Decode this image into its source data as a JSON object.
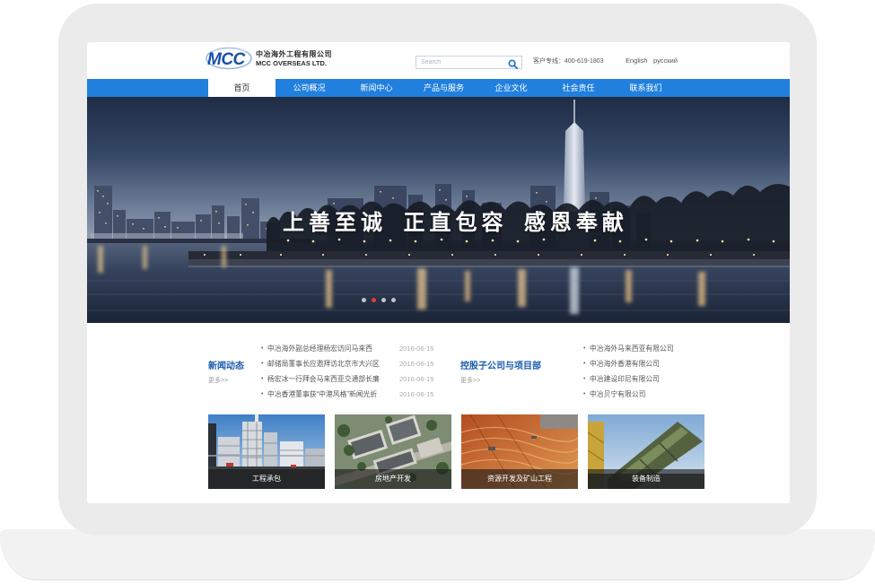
{
  "header": {
    "logo_text": "MCC",
    "company_cn": "中冶海外工程有限公司",
    "company_en": "MCC OVERSEAS LTD.",
    "search_placeholder": "Search",
    "hotline": "客户专线：400-619-1803",
    "languages": [
      "English",
      "русский"
    ]
  },
  "nav": {
    "items": [
      {
        "label": "首页",
        "active": true
      },
      {
        "label": "公司概况"
      },
      {
        "label": "新闻中心"
      },
      {
        "label": "产品与服务"
      },
      {
        "label": "企业文化"
      },
      {
        "label": "社会责任"
      },
      {
        "label": "联系我们"
      }
    ]
  },
  "banner": {
    "slogan": [
      "上善至诚",
      "正直包容",
      "感恩奉献"
    ],
    "dot_count": 4,
    "active_dot": 2
  },
  "news": {
    "title": "新闻动态",
    "more": "更多>>",
    "items": [
      {
        "title": "中冶海外副总经理杨宏访问马来西",
        "date": "2016-06-15"
      },
      {
        "title": "邮储局董事长应邀拜访北京市大兴区",
        "date": "2016-06-15"
      },
      {
        "title": "杨宏冰一行拜会马来西亚交通部长廉",
        "date": "2016-06-15"
      },
      {
        "title": "中冶香港董事获“中港风格”新闻光折",
        "date": "2016-06-15"
      }
    ]
  },
  "subsidiaries": {
    "title": "控股子公司与项目部",
    "more": "更多>>",
    "items": [
      "中冶海外马来西亚有限公司",
      "中冶海外香港有限公司",
      "中冶建设印尼有限公司",
      "中冶贝宁有限公司"
    ]
  },
  "tiles": [
    {
      "caption": "工程承包",
      "icon": "industrial-plant-image"
    },
    {
      "caption": "房地产开发",
      "icon": "real-estate-aerial-image"
    },
    {
      "caption": "资源开发及矿山工程",
      "icon": "mining-site-image"
    },
    {
      "caption": "装备制造",
      "icon": "equipment-machinery-image"
    }
  ],
  "colors": {
    "nav": "#2180de",
    "title": "#1a5bb0",
    "dot": "#e5432c"
  }
}
